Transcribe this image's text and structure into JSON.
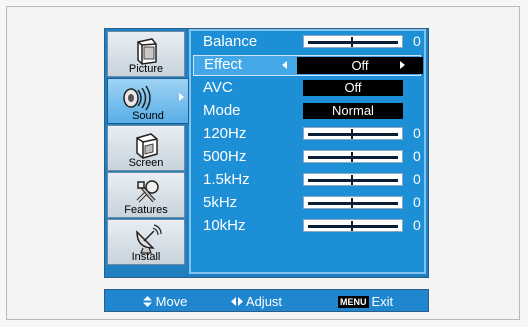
{
  "sidebar": {
    "items": [
      {
        "label": "Picture",
        "icon": "picture-icon"
      },
      {
        "label": "Sound",
        "icon": "speaker-icon"
      },
      {
        "label": "Screen",
        "icon": "screen-icon"
      },
      {
        "label": "Features",
        "icon": "tools-icon"
      },
      {
        "label": "Install",
        "icon": "satellite-dish-icon"
      }
    ],
    "active": "Sound"
  },
  "menu": {
    "rows": [
      {
        "label": "Balance",
        "type": "slider",
        "value": "0"
      },
      {
        "label": "Effect",
        "type": "option",
        "value": "Off"
      },
      {
        "label": "AVC",
        "type": "option",
        "value": "Off"
      },
      {
        "label": "Mode",
        "type": "option",
        "value": "Normal"
      },
      {
        "label": "120Hz",
        "type": "slider",
        "value": "0"
      },
      {
        "label": "500Hz",
        "type": "slider",
        "value": "0"
      },
      {
        "label": "1.5kHz",
        "type": "slider",
        "value": "0"
      },
      {
        "label": "5kHz",
        "type": "slider",
        "value": "0"
      },
      {
        "label": "10kHz",
        "type": "slider",
        "value": "0"
      }
    ],
    "selected": "Effect"
  },
  "footer": {
    "move": "Move",
    "adjust": "Adjust",
    "menu_key": "MENU",
    "exit": "Exit"
  },
  "colors": {
    "panel": "#1c8fd6",
    "selected_row": "#43a7e8",
    "value_box": "#000000"
  }
}
